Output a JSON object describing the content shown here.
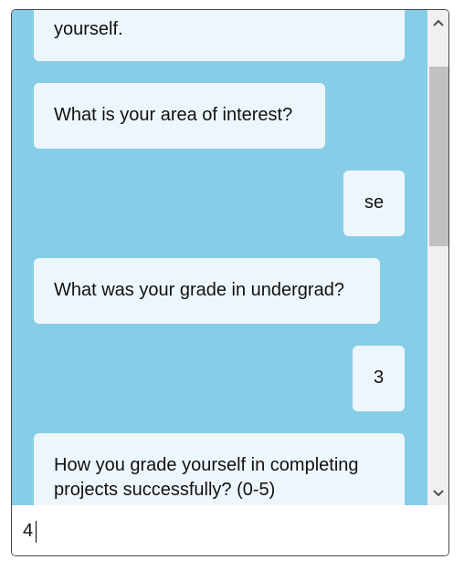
{
  "chat": {
    "messages": [
      {
        "sender": "bot",
        "text": "yourself."
      },
      {
        "sender": "bot",
        "text": "What is your area of interest?"
      },
      {
        "sender": "user",
        "text": "se"
      },
      {
        "sender": "bot",
        "text": "What was your grade in undergrad?"
      },
      {
        "sender": "user",
        "text": "3"
      },
      {
        "sender": "bot",
        "lines": [
          "How you grade yourself in completing",
          "projects successfully? (0-5)"
        ]
      }
    ]
  },
  "input": {
    "value": "4",
    "placeholder": ""
  },
  "scrollbar": {
    "up_icon": "chevron-up-icon",
    "down_icon": "chevron-down-icon"
  },
  "colors": {
    "chat_background": "#87cde8",
    "bubble_background": "#eef6fd"
  }
}
